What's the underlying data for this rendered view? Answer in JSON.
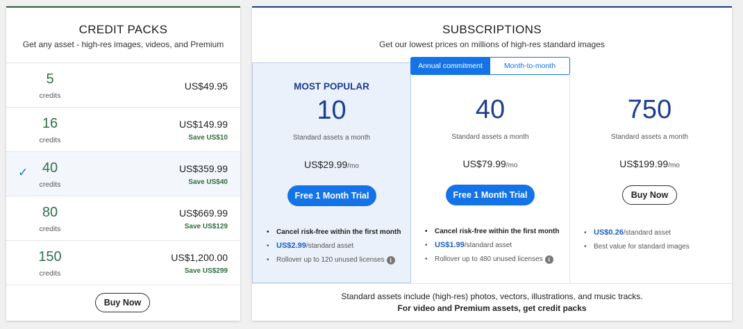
{
  "credit_packs": {
    "title": "CREDIT PACKS",
    "subtitle": "Get any asset - high-res images, videos, and Premium",
    "packs": [
      {
        "credits": "5",
        "unit": "credits",
        "price": "US$49.95",
        "save": ""
      },
      {
        "credits": "16",
        "unit": "credits",
        "price": "US$149.99",
        "save": "Save US$10"
      },
      {
        "credits": "40",
        "unit": "credits",
        "price": "US$359.99",
        "save": "Save US$40",
        "selected": true
      },
      {
        "credits": "80",
        "unit": "credits",
        "price": "US$669.99",
        "save": "Save US$129"
      },
      {
        "credits": "150",
        "unit": "credits",
        "price": "US$1,200.00",
        "save": "Save US$299"
      }
    ],
    "check_icon": "✓",
    "buy_label": "Buy Now"
  },
  "subscriptions": {
    "title": "SUBSCRIPTIONS",
    "subtitle": "Get our lowest prices on millions of high-res standard images",
    "toggle": {
      "annual": "Annual commitment",
      "monthly": "Month-to-month"
    },
    "plans": [
      {
        "popular_label": "MOST POPULAR",
        "count": "10",
        "desc": "Standard assets a month",
        "price": "US$29.99",
        "per": "/mo",
        "button": "Free 1 Month Trial",
        "feat1": "Cancel risk-free within the first month",
        "feat2_price": "US$2.99",
        "feat2_rest": "/standard asset",
        "feat3": "Rollover up to 120 unused licenses"
      },
      {
        "count": "40",
        "desc": "Standard assets a month",
        "price": "US$79.99",
        "per": "/mo",
        "button": "Free 1 Month Trial",
        "feat1": "Cancel risk-free within the first month",
        "feat2_price": "US$1.99",
        "feat2_rest": "/standard asset",
        "feat3": "Rollover up to 480 unused licenses"
      },
      {
        "count": "750",
        "desc": "Standard assets a month",
        "price": "US$199.99",
        "per": "/mo",
        "button": "Buy Now",
        "feat1_price": "US$0.26",
        "feat1_rest": "/standard asset",
        "feat2": "Best value for standard images"
      }
    ],
    "info_icon": "i",
    "footer_line1": "Standard assets include (high-res) photos, vectors, illustrations, and music tracks.",
    "footer_line2": "For video and Premium assets, get credit packs"
  },
  "colors": {
    "accent_blue": "#1473e6",
    "plan_number_blue": "#1a3d8f",
    "credit_green": "#2e7048",
    "popular_bg": "#eaf1fb"
  }
}
